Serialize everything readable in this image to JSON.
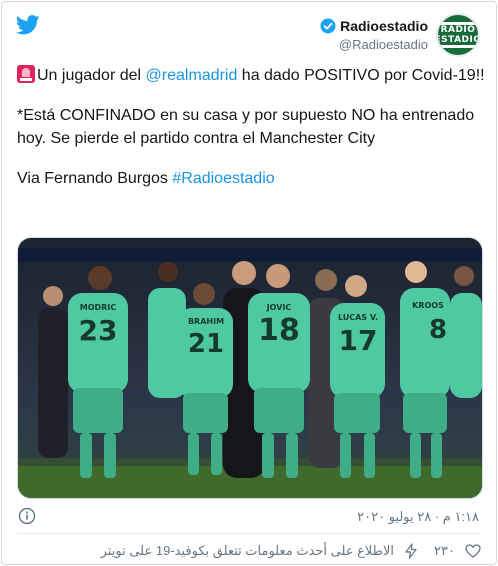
{
  "header": {
    "display_name": "Radioestadio",
    "handle": "@Radioestadio",
    "avatar_text_top": "RADIO",
    "avatar_text_bottom": "ESTADIO"
  },
  "tweet": {
    "line1_prefix": "Un jugador del ",
    "mention": "@realmadrid",
    "line1_suffix": " ha dado POSITIVO por Covid-19!!",
    "paragraph2": "*Está CONFINADO en su casa y por supuesto NO ha entrenado hoy. Se pierde el partido contra el Manchester City",
    "via_prefix": "Via Fernando Burgos ",
    "hashtag": "#Radioestadio"
  },
  "media": {
    "jersey_numbers": [
      "23",
      "21",
      "18",
      "17",
      "8"
    ],
    "jersey_names": [
      "MODRIC",
      "BRAHIM",
      "JOVIC",
      "LUCAS V.",
      "KROOS"
    ]
  },
  "meta": {
    "timestamp": "١:١٨ م · ٢٨ يوليو ٢٠٢٠"
  },
  "footer": {
    "likes": "٢٣٠",
    "covid_info": "الاطلاع على أحدث معلومات تتعلق بكوفيد-19 على تويتر"
  },
  "colors": {
    "twitter_blue": "#1da1f2",
    "link": "#1b95e0",
    "muted": "#657786",
    "jersey_green": "#4fc9a2"
  }
}
